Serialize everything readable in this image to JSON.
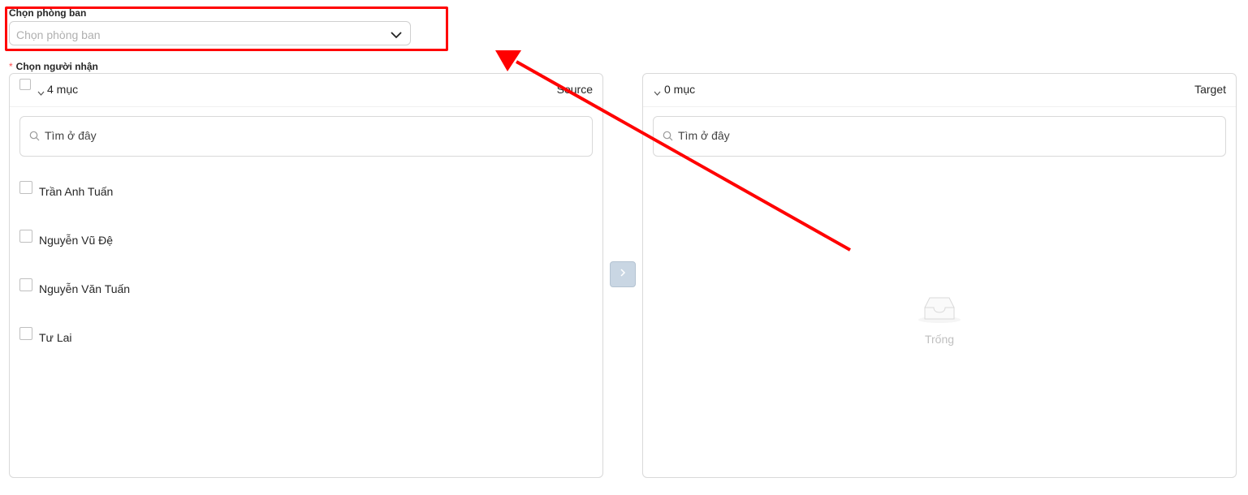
{
  "department": {
    "label": "Chọn phòng ban",
    "placeholder": "Chọn phòng ban"
  },
  "recipients": {
    "required_mark": "*",
    "label": "Chọn người nhận"
  },
  "source": {
    "count_label": "4 mục",
    "title": "Source",
    "search_placeholder": "Tìm ở đây",
    "items": [
      {
        "name": "Trần Anh Tuấn"
      },
      {
        "name": "Nguyễn Vũ Đệ"
      },
      {
        "name": "Nguyễn Văn Tuấn"
      },
      {
        "name": "Tư Lai"
      }
    ]
  },
  "target": {
    "count_label": "0 mục",
    "title": "Target",
    "search_placeholder": "Tìm ở đây",
    "empty_text": "Trống"
  },
  "colors": {
    "annotation": "#ff0000",
    "transfer_button": "#c9d6e3",
    "required": "#ff4d4f"
  },
  "icons": {
    "dropdown": "chevron-down-icon",
    "search": "search-icon",
    "transfer": "chevron-right-icon",
    "empty": "inbox-icon"
  }
}
